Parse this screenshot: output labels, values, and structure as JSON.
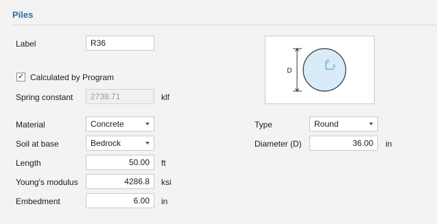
{
  "section": {
    "title": "Piles"
  },
  "form": {
    "label": {
      "label": "Label",
      "value": "R36"
    },
    "calculated": {
      "label": "Calculated by Program",
      "checked": true,
      "check_glyph": "✓"
    },
    "spring": {
      "label": "Spring constant",
      "value": "2738.71",
      "unit": "klf"
    },
    "material": {
      "label": "Material",
      "value": "Concrete"
    },
    "soil": {
      "label": "Soil at base",
      "value": "Bedrock"
    },
    "length": {
      "label": "Length",
      "value": "50.00",
      "unit": "ft"
    },
    "youngs": {
      "label": "Young's modulus",
      "value": "4286.8",
      "unit": "ksi"
    },
    "embedment": {
      "label": "Embedment",
      "value": "6.00",
      "unit": "in"
    },
    "type": {
      "label": "Type",
      "value": "Round"
    },
    "diameter": {
      "label": "Diameter (D)",
      "value": "36.00",
      "unit": "in"
    }
  },
  "preview": {
    "dim_label": "D",
    "axis_y": "y",
    "axis_x": "x",
    "fill_color": "#d7ebf8",
    "stroke_color": "#333333",
    "axis_color": "#4a90c8"
  }
}
